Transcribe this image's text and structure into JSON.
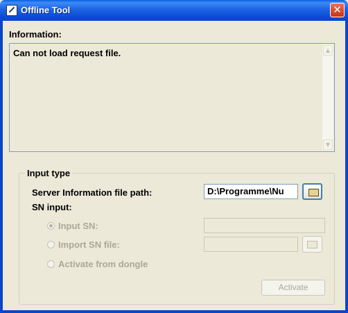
{
  "window": {
    "title": "Offline Tool",
    "close_symbol": "✕",
    "app_icon": "tool-icon"
  },
  "info": {
    "label": "Information:",
    "text": "Can not load request file.",
    "scroll_up": "▲",
    "scroll_down": "▼"
  },
  "input_type": {
    "legend": "Input type",
    "server_label": "Server Information file path:",
    "server_path": "D:\\Programme\\Nu",
    "folder_icon": "open-folder-icon",
    "sn_label": "SN input:",
    "options": [
      {
        "label": "Input SN:",
        "checked": true,
        "enabled": false
      },
      {
        "label": "Import SN file:",
        "checked": false,
        "enabled": false
      },
      {
        "label": "Activate from dongle",
        "checked": false,
        "enabled": false
      }
    ],
    "sn_value": "",
    "import_value": "",
    "activate_label": "Activate",
    "colors": {
      "disabled_text": "#aca899",
      "window_bg": "#ece9d8",
      "titlebar": "#0a4cd6"
    }
  }
}
